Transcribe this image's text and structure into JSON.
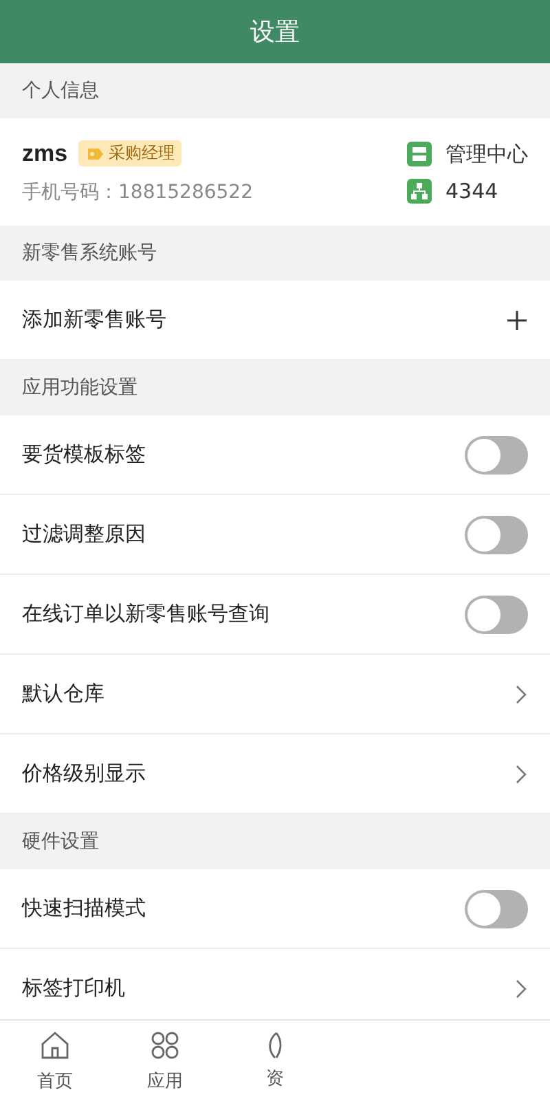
{
  "title_bar": {
    "title": "设置"
  },
  "sections": [
    {
      "header": "个人信息",
      "kind": "profile",
      "profile": {
        "name": "zms",
        "role": "采购经理",
        "phone": "手机号码：18815286522",
        "links": [
          {
            "kind": "store",
            "label": "管理中心"
          },
          {
            "kind": "org",
            "label": "4344"
          }
        ]
      }
    },
    {
      "header": "新零售系统账号",
      "kind": "rows",
      "rows": [
        {
          "kind": "add",
          "label": "添加新零售账号"
        }
      ]
    },
    {
      "header": "应用功能设置",
      "kind": "rows",
      "rows": [
        {
          "kind": "toggle",
          "label": "要货模板标签",
          "on": false
        },
        {
          "kind": "toggle",
          "label": "过滤调整原因",
          "on": false
        },
        {
          "kind": "toggle",
          "label": "在线订单以新零售账号查询",
          "on": false
        },
        {
          "kind": "nav",
          "label": "默认仓库"
        },
        {
          "kind": "nav",
          "label": "价格级别显示"
        }
      ]
    },
    {
      "header": "硬件设置",
      "kind": "rows",
      "rows": [
        {
          "kind": "toggle",
          "label": "快速扫描模式",
          "on": false
        },
        {
          "kind": "nav",
          "label": "标签打印机"
        }
      ]
    }
  ],
  "tab_bar": [
    {
      "kind": "home",
      "label": "首页"
    },
    {
      "kind": "apps",
      "label": "应用"
    },
    {
      "kind": "leaf",
      "label": "资"
    }
  ]
}
